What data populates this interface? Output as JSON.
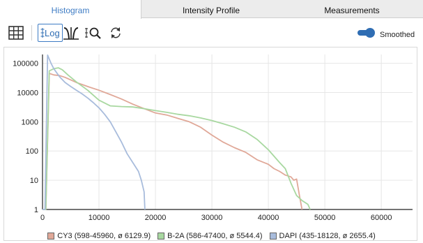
{
  "tabs": [
    {
      "label": "Histogram",
      "active": true
    },
    {
      "label": "Intensity Profile",
      "active": false
    },
    {
      "label": "Measurements",
      "active": false
    }
  ],
  "toolbar": {
    "log_label": "Log",
    "smoothed_label": "Smoothed",
    "smoothed_on": true,
    "icons": [
      "grid-table-icon",
      "log-scale-icon",
      "threshold-icon",
      "zoom-to-fit-icon",
      "refresh-icon"
    ]
  },
  "chart_data": {
    "type": "line",
    "x_ticks": [
      0,
      10000,
      20000,
      30000,
      40000,
      50000,
      60000
    ],
    "y_scale": "log",
    "y_ticks": [
      1,
      10,
      100,
      1000,
      10000,
      100000
    ],
    "xlim": [
      0,
      65535
    ],
    "ylim": [
      1,
      200000
    ],
    "grid": true,
    "legend_position": "bottom",
    "series": [
      {
        "name": "CY3 (598-45960, ø 6129.9)",
        "color": "#e0a898",
        "x": [
          0,
          598,
          1200,
          2000,
          3000,
          4000,
          5000,
          6000,
          8000,
          10000,
          12000,
          14000,
          16000,
          18000,
          20000,
          22000,
          24000,
          26000,
          28000,
          30000,
          32000,
          34000,
          36000,
          38000,
          40000,
          41000,
          42000,
          43000,
          44000,
          44500,
          45000,
          45500,
          45960
        ],
        "y": [
          1,
          1,
          45000,
          40000,
          38000,
          33000,
          27000,
          22000,
          16000,
          12000,
          8500,
          6000,
          4000,
          2800,
          2000,
          1700,
          1300,
          1000,
          650,
          350,
          200,
          130,
          90,
          50,
          35,
          25,
          20,
          15,
          13,
          10,
          11,
          3,
          1
        ]
      },
      {
        "name": "B-2A (586-47400, ø 5544.4)",
        "color": "#a8d8a0",
        "x": [
          0,
          586,
          1200,
          2000,
          2800,
          3500,
          4500,
          6000,
          8000,
          10000,
          12000,
          14000,
          16000,
          18000,
          20000,
          22000,
          24000,
          26000,
          28000,
          30000,
          32000,
          34000,
          36000,
          38000,
          40000,
          42000,
          43000,
          44000,
          45000,
          46000,
          47000,
          47400
        ],
        "y": [
          1,
          1,
          55000,
          65000,
          70000,
          60000,
          40000,
          23000,
          12000,
          5500,
          3500,
          3300,
          3200,
          2800,
          2400,
          2100,
          1800,
          1600,
          1350,
          1100,
          850,
          650,
          450,
          250,
          110,
          40,
          25,
          8,
          3,
          2,
          1.5,
          1
        ]
      },
      {
        "name": "DAPI (435-18128, ø 2655.4)",
        "color": "#a8bcdc",
        "x": [
          0,
          435,
          900,
          1500,
          2000,
          3000,
          4000,
          5000,
          6000,
          7000,
          8000,
          9000,
          10000,
          11000,
          12000,
          13000,
          14000,
          15000,
          16000,
          17000,
          17500,
          18000,
          18128
        ],
        "y": [
          1,
          1,
          190000,
          100000,
          65000,
          35000,
          22000,
          16000,
          12000,
          9000,
          6500,
          4500,
          3000,
          1800,
          1000,
          450,
          200,
          80,
          40,
          20,
          10,
          4,
          1
        ]
      }
    ]
  }
}
